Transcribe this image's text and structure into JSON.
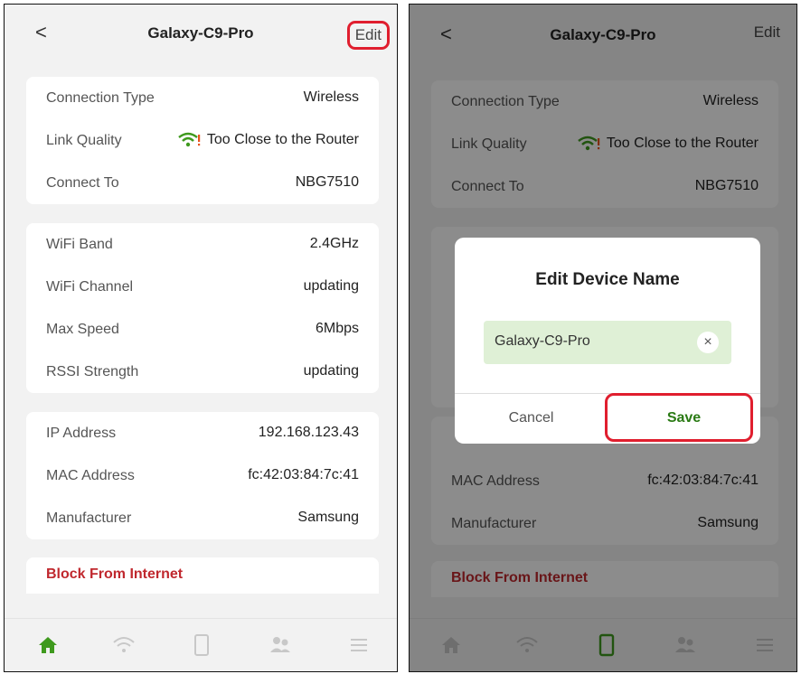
{
  "left": {
    "nav": {
      "back": "<",
      "title": "Galaxy-C9-Pro",
      "edit": "Edit"
    },
    "rows1": [
      {
        "label": "Connection Type",
        "value": "Wireless"
      },
      {
        "label": "Link Quality",
        "value": "Too Close to the Router"
      },
      {
        "label": "Connect To",
        "value": "NBG7510"
      }
    ],
    "rows2": [
      {
        "label": "WiFi Band",
        "value": "2.4GHz"
      },
      {
        "label": "WiFi Channel",
        "value": "updating"
      },
      {
        "label": "Max Speed",
        "value": "6Mbps"
      },
      {
        "label": "RSSI Strength",
        "value": "updating"
      }
    ],
    "rows3": [
      {
        "label": "IP Address",
        "value": "192.168.123.43"
      },
      {
        "label": "MAC Address",
        "value": "fc:42:03:84:7c:41"
      },
      {
        "label": "Manufacturer",
        "value": "Samsung"
      }
    ],
    "block": "Block From Internet",
    "tabs": [
      "home-icon",
      "wifi-icon",
      "phone-icon",
      "users-icon",
      "menu-icon"
    ],
    "active_tab": "home-icon"
  },
  "right": {
    "nav": {
      "back": "<",
      "title": "Galaxy-C9-Pro",
      "edit": "Edit"
    },
    "rows1": [
      {
        "label": "Connection Type",
        "value": "Wireless"
      },
      {
        "label": "Link Quality",
        "value": "Too Close to the Router"
      },
      {
        "label": "Connect To",
        "value": "NBG7510"
      }
    ],
    "rows3": [
      {
        "label": "MAC Address",
        "value": "fc:42:03:84:7c:41"
      },
      {
        "label": "Manufacturer",
        "value": "Samsung"
      }
    ],
    "block": "Block From Internet",
    "active_tab": "phone-icon",
    "dialog": {
      "title": "Edit Device Name",
      "input_value": "Galaxy-C9-Pro",
      "clear": "×",
      "cancel": "Cancel",
      "save": "Save"
    }
  },
  "colors": {
    "accent_green": "#3f9a1e",
    "highlight_red": "#e01e2e",
    "block_red": "#c0282e"
  }
}
